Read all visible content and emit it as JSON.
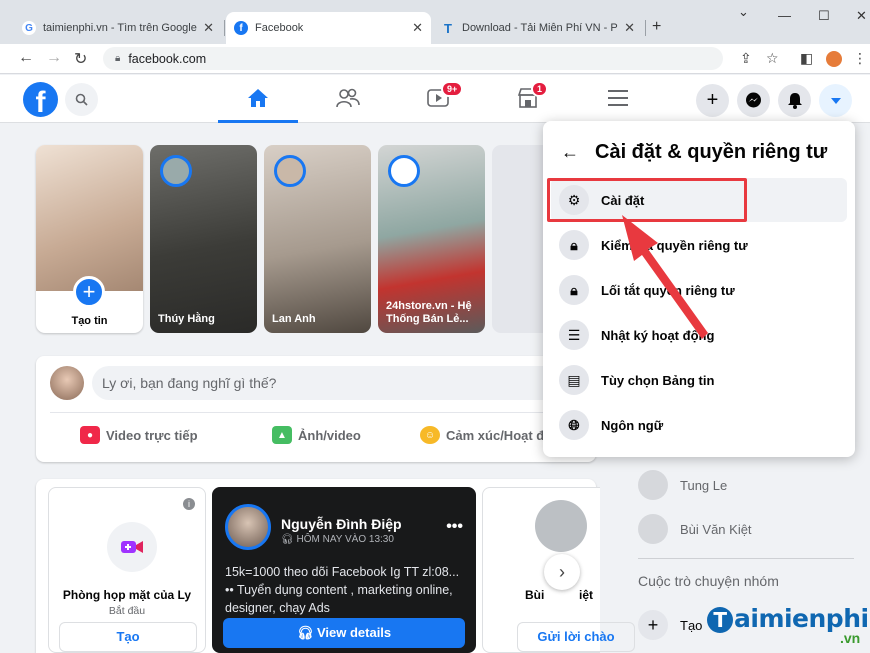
{
  "browser": {
    "tabs": [
      {
        "title": "taimienphi.vn - Tìm trên Google",
        "favicon": "G"
      },
      {
        "title": "Facebook",
        "favicon": "f"
      },
      {
        "title": "Download - Tải Miễn Phí VN - Ph",
        "favicon": "T"
      }
    ],
    "new_tab": "+",
    "controls": {
      "dropdown": "⌄",
      "minimize": "—",
      "maximize": "☐",
      "close": "✕"
    },
    "url": "facebook.com"
  },
  "fb_nav": {
    "logo": "f",
    "badges": {
      "watch": "9+",
      "marketplace": "1"
    }
  },
  "stories": [
    {
      "name": "Tạo tin"
    },
    {
      "name": "Thúy Hằng"
    },
    {
      "name": "Lan Anh"
    },
    {
      "name": "24hstore.vn - Hệ Thống Bán Lẻ..."
    }
  ],
  "composer": {
    "placeholder": "Ly ơi, bạn đang nghĩ gì thế?",
    "actions": [
      "Video trực tiếp",
      "Ảnh/video",
      "Cảm xúc/Hoạt đ"
    ]
  },
  "rooms": {
    "room_title": "Phòng họp mặt của Ly",
    "room_sub": "Bắt đầu",
    "room_button": "Tạo",
    "post_name": "Nguyễn Đình Điệp",
    "post_time": "HÔM NAY VÀO 13:30",
    "post_line1": "15k=1000 theo dõi Facebook Ig TT zl:08...",
    "post_line2": "Tuyển dụng content , marketing online,",
    "post_line3": "designer, chạy Ads",
    "view_details": "View details",
    "third_name": "Bùi",
    "third_name_end": "iệt",
    "third_button": "Gửi lời chào"
  },
  "sidebar": {
    "contacts": [
      "Tung Le",
      "Bùi Văn Kiệt"
    ],
    "group_heading": "Cuộc trò chuyện nhóm",
    "create_label": "Tạo"
  },
  "settings_menu": {
    "title": "Cài đặt & quyền riêng tư",
    "items": [
      {
        "label": "Cài đặt",
        "icon": "gear-icon"
      },
      {
        "label": "Kiểm tra quyền riêng tư",
        "icon": "lock-check-icon"
      },
      {
        "label": "Lối tắt quyền riêng tư",
        "icon": "lock-icon"
      },
      {
        "label": "Nhật ký hoạt động",
        "icon": "list-icon"
      },
      {
        "label": "Tùy chọn Bảng tin",
        "icon": "feed-icon"
      },
      {
        "label": "Ngôn ngữ",
        "icon": "globe-icon"
      }
    ]
  },
  "watermark": {
    "brand": "aimienphi",
    "tld": ".vn"
  },
  "colors": {
    "fb_blue": "#1877f2",
    "highlight_red": "#e8393f",
    "badge_red": "#e41e3f"
  }
}
